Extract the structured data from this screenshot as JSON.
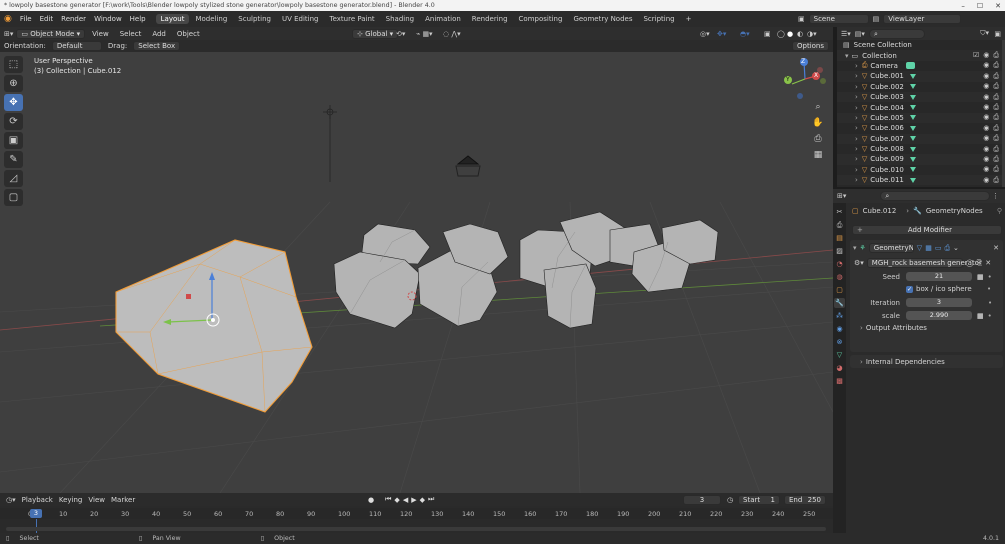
{
  "window": {
    "title": "* lowpoly basestone generator [F:\\work\\Tools\\Blender lowpoly stylized stone generator\\lowpoly basestone generator.blend] - Blender 4.0"
  },
  "menu": [
    "File",
    "Edit",
    "Render",
    "Window",
    "Help"
  ],
  "workspaces": [
    {
      "label": "Layout",
      "active": true
    },
    {
      "label": "Modeling"
    },
    {
      "label": "Sculpting"
    },
    {
      "label": "UV Editing"
    },
    {
      "label": "Texture Paint"
    },
    {
      "label": "Shading"
    },
    {
      "label": "Animation"
    },
    {
      "label": "Rendering"
    },
    {
      "label": "Compositing"
    },
    {
      "label": "Geometry Nodes"
    },
    {
      "label": "Scripting"
    },
    {
      "label": "+"
    }
  ],
  "scene": {
    "name": "Scene",
    "view_layer": "ViewLayer"
  },
  "header3d": {
    "mode": "Object Mode",
    "menus": [
      "View",
      "Select",
      "Add",
      "Object"
    ],
    "transform": "Global",
    "options": "Options"
  },
  "header2": {
    "orientation_label": "Orientation:",
    "orientation": "Default",
    "drag_label": "Drag:",
    "drag": "Select Box"
  },
  "viewport": {
    "perspective": "User Perspective",
    "collection": "(3) Collection | Cube.012"
  },
  "gizmo": {
    "x": "X",
    "y": "Y",
    "z": "Z"
  },
  "outliner": {
    "root": "Scene Collection",
    "collection": "Collection",
    "items": [
      "Camera",
      "Cube.001",
      "Cube.002",
      "Cube.003",
      "Cube.004",
      "Cube.005",
      "Cube.006",
      "Cube.007",
      "Cube.008",
      "Cube.009",
      "Cube.010",
      "Cube.011"
    ]
  },
  "properties": {
    "breadcrumb_object": "Cube.012",
    "breadcrumb_modifier": "GeometryNodes",
    "add_modifier": "Add Modifier",
    "modifier_name": "GeometryNo...",
    "node_group": "MGH_rock basemesh generator",
    "fields": [
      {
        "label": "Seed",
        "value": "21"
      },
      {
        "label": "Iteration",
        "value": "3"
      },
      {
        "label": "scale",
        "value": "2.990"
      }
    ],
    "checkbox": {
      "label": "box / ico sphere",
      "checked": true
    },
    "sections": [
      "Output Attributes",
      "Internal Dependencies"
    ]
  },
  "timeline": {
    "menus": [
      "Playback",
      "Keying",
      "View",
      "Marker"
    ],
    "current": "3",
    "start_label": "Start",
    "start": "1",
    "end_label": "End",
    "end": "250",
    "ruler": [
      "0",
      "10",
      "20",
      "30",
      "40",
      "50",
      "60",
      "70",
      "80",
      "90",
      "100",
      "110",
      "120",
      "130",
      "140",
      "150",
      "160",
      "170",
      "180",
      "190",
      "200",
      "210",
      "220",
      "230",
      "240",
      "250"
    ],
    "cursor": "3"
  },
  "status": {
    "select": "Select",
    "pan": "Pan View",
    "object": "Object",
    "version": "4.0.1"
  },
  "colors": {
    "accent": "#4772b3",
    "selected_outline": "#f29d38",
    "mesh_icon": "#5fd3a8"
  }
}
